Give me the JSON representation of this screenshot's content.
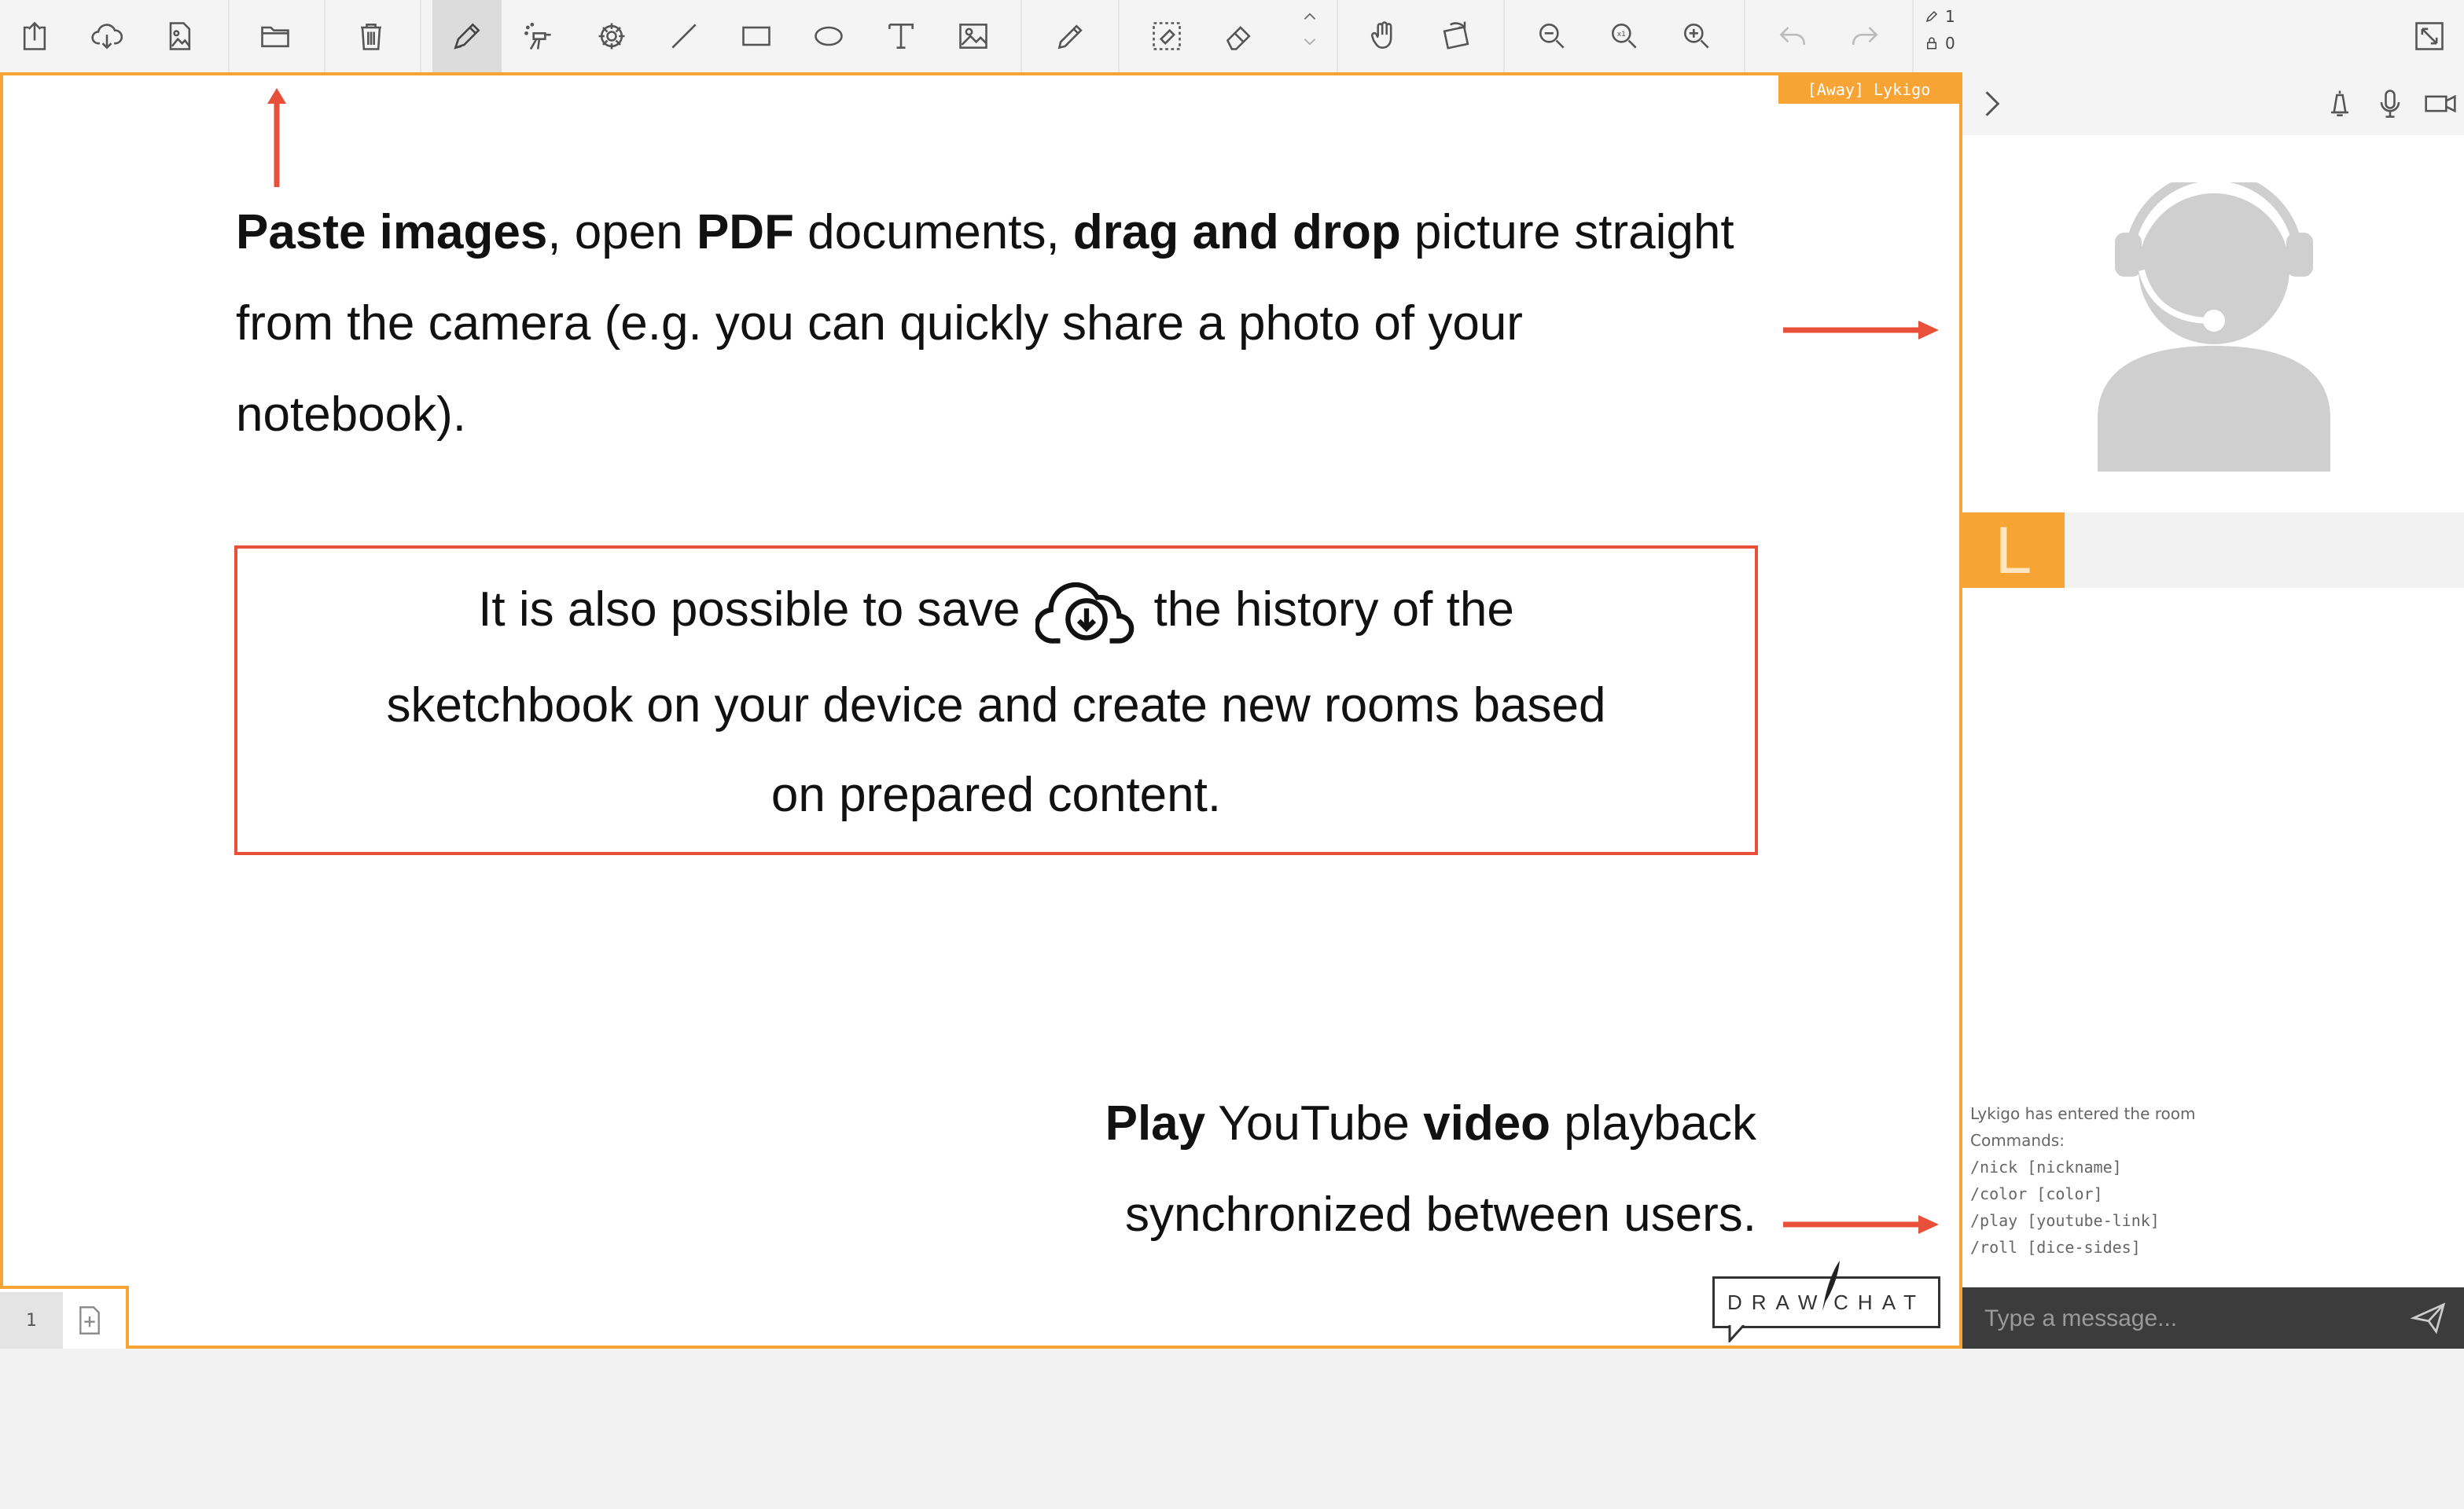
{
  "colors": {
    "accent": "#f7a434",
    "annotation": "#e8503a",
    "chat_bar": "#3c3c3c"
  },
  "toolbar": {
    "icons": [
      "export-icon",
      "cloud-download-icon",
      "image-icon",
      "folder-icon",
      "trash-icon",
      "pencil-icon",
      "spray-icon",
      "spiral-icon",
      "line-icon",
      "rectangle-icon",
      "ellipse-icon",
      "text-icon",
      "insert-image-icon",
      "eyedropper-icon",
      "select-eraser-icon",
      "eraser-icon",
      "size-up-icon",
      "hand-icon",
      "rotate-icon",
      "zoom-out-icon",
      "zoom-reset-icon",
      "zoom-in-icon",
      "undo-icon",
      "redo-icon",
      "fullscreen-icon"
    ],
    "active_tool": "pencil",
    "pencil_count": "1",
    "lock_count": "0"
  },
  "canvas": {
    "status_tag": "[Away] Lykigo",
    "p1": {
      "b1": "Paste images",
      "t1": ", open ",
      "b2": "PDF",
      "t2": " documents, ",
      "b3": "drag and drop",
      "t3": " picture straight",
      "line2": "from the camera (e.g. you can quickly share a photo of your",
      "line3": "notebook)."
    },
    "box": {
      "line1_a": "It is also possible to save",
      "line1_b": "the history of the",
      "line2": "sketchbook on your device and create new rooms based",
      "line3": "on prepared content."
    },
    "p3": {
      "b1": "Play",
      "t1": " YouTube ",
      "b2": "video",
      "t2": " playback",
      "line2": "synchronized between users."
    },
    "logo_left": "DRAW",
    "logo_right": "CHAT",
    "page_number": "1"
  },
  "side": {
    "user_initial": "L",
    "chat": {
      "entered": "Lykigo has entered the room",
      "commands_label": "Commands:",
      "commands": [
        "/nick [nickname]",
        "/color [color]",
        "/play [youtube-link]",
        "/roll [dice-sides]"
      ],
      "placeholder": "Type a message..."
    }
  }
}
